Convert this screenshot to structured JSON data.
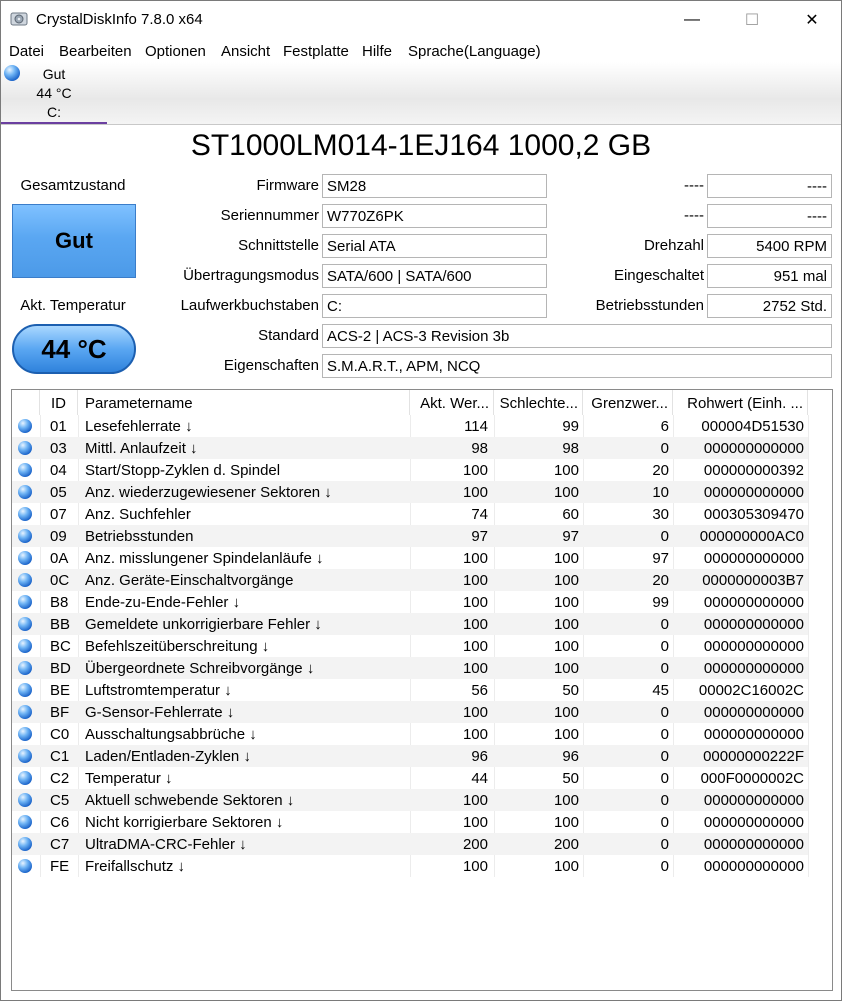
{
  "window": {
    "title": "CrystalDiskInfo 7.8.0 x64",
    "minimize": "—",
    "maximize": "☐",
    "close": "✕"
  },
  "menu": [
    "Datei",
    "Bearbeiten",
    "Optionen",
    "Ansicht",
    "Festplatte",
    "Hilfe",
    "Sprache(Language)"
  ],
  "disk_tab": {
    "status": "Gut",
    "temperature": "44 °C",
    "drive": "C:"
  },
  "disk": {
    "model": "ST1000LM014-1EJ164 1000,2 GB",
    "health_label": "Gesamtzustand",
    "health_value": "Gut",
    "temp_label": "Akt. Temperatur",
    "temp_value": "44 °C",
    "left_fields": [
      {
        "label": "Firmware",
        "value": "SM28"
      },
      {
        "label": "Seriennummer",
        "value": "W770Z6PK"
      },
      {
        "label": "Schnittstelle",
        "value": "Serial ATA"
      },
      {
        "label": "Übertragungsmodus",
        "value": "SATA/600 | SATA/600"
      },
      {
        "label": "Laufwerkbuchstaben",
        "value": "C:"
      }
    ],
    "wide_fields": [
      {
        "label": "Standard",
        "value": "ACS-2 | ACS-3 Revision 3b"
      },
      {
        "label": "Eigenschaften",
        "value": "S.M.A.R.T., APM, NCQ"
      }
    ],
    "right_fields": [
      {
        "label": "----",
        "value": "----"
      },
      {
        "label": "----",
        "value": "----"
      },
      {
        "label": "Drehzahl",
        "value": "5400 RPM"
      },
      {
        "label": "Eingeschaltet",
        "value": "951 mal"
      },
      {
        "label": "Betriebsstunden",
        "value": "2752 Std."
      }
    ]
  },
  "smart": {
    "headers": [
      "ID",
      "Parametername",
      "Akt. Wer...",
      "Schlechte...",
      "Grenzwer...",
      "Rohwert (Einh. ..."
    ],
    "rows": [
      [
        "01",
        "Lesefehlerrate ↓",
        "114",
        "99",
        "6",
        "000004D51530"
      ],
      [
        "03",
        "Mittl. Anlaufzeit ↓",
        "98",
        "98",
        "0",
        "000000000000"
      ],
      [
        "04",
        "Start/Stopp-Zyklen d. Spindel",
        "100",
        "100",
        "20",
        "000000000392"
      ],
      [
        "05",
        "Anz. wiederzugewiesener Sektoren ↓",
        "100",
        "100",
        "10",
        "000000000000"
      ],
      [
        "07",
        "Anz. Suchfehler",
        "74",
        "60",
        "30",
        "000305309470"
      ],
      [
        "09",
        "Betriebsstunden",
        "97",
        "97",
        "0",
        "000000000AC0"
      ],
      [
        "0A",
        "Anz. misslungener Spindelanläufe ↓",
        "100",
        "100",
        "97",
        "000000000000"
      ],
      [
        "0C",
        "Anz. Geräte-Einschaltvorgänge",
        "100",
        "100",
        "20",
        "0000000003B7"
      ],
      [
        "B8",
        "Ende-zu-Ende-Fehler ↓",
        "100",
        "100",
        "99",
        "000000000000"
      ],
      [
        "BB",
        "Gemeldete unkorrigierbare Fehler ↓",
        "100",
        "100",
        "0",
        "000000000000"
      ],
      [
        "BC",
        "Befehlszeitüberschreitung ↓",
        "100",
        "100",
        "0",
        "000000000000"
      ],
      [
        "BD",
        "Übergeordnete Schreibvorgänge ↓",
        "100",
        "100",
        "0",
        "000000000000"
      ],
      [
        "BE",
        "Luftstromtemperatur ↓",
        "56",
        "50",
        "45",
        "00002C16002C"
      ],
      [
        "BF",
        "G-Sensor-Fehlerrate ↓",
        "100",
        "100",
        "0",
        "000000000000"
      ],
      [
        "C0",
        "Ausschaltungsabbrüche ↓",
        "100",
        "100",
        "0",
        "000000000000"
      ],
      [
        "C1",
        "Laden/Entladen-Zyklen ↓",
        "96",
        "96",
        "0",
        "00000000222F"
      ],
      [
        "C2",
        "Temperatur ↓",
        "44",
        "50",
        "0",
        "000F0000002C"
      ],
      [
        "C5",
        "Aktuell schwebende Sektoren ↓",
        "100",
        "100",
        "0",
        "000000000000"
      ],
      [
        "C6",
        "Nicht korrigierbare Sektoren ↓",
        "100",
        "100",
        "0",
        "000000000000"
      ],
      [
        "C7",
        "UltraDMA-CRC-Fehler ↓",
        "200",
        "200",
        "0",
        "000000000000"
      ],
      [
        "FE",
        "Freifallschutz ↓",
        "100",
        "100",
        "0",
        "000000000000"
      ]
    ]
  }
}
